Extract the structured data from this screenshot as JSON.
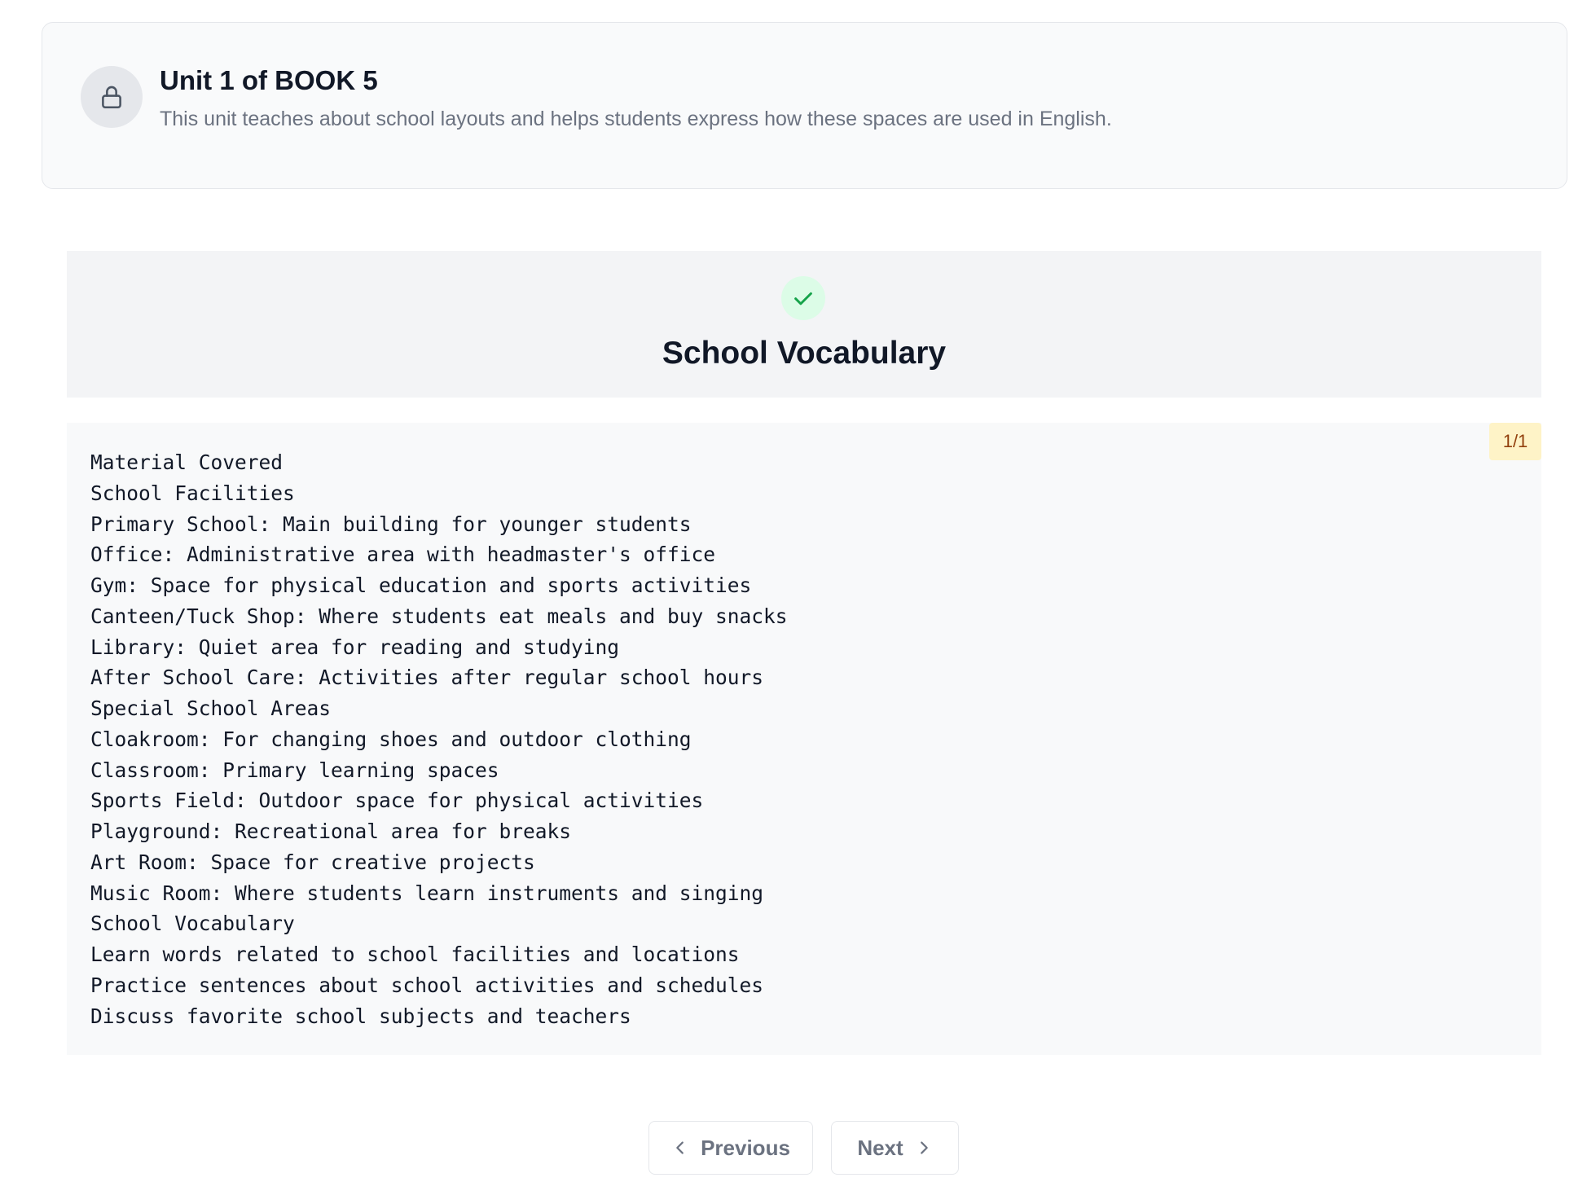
{
  "unit": {
    "title": "Unit 1 of BOOK 5",
    "description": "This unit teaches about school layouts and helps students express how these spaces are used in English.",
    "icon": "lock-icon"
  },
  "lesson": {
    "title": "School Vocabulary",
    "status_icon": "check-icon",
    "status_color": "#16a34a"
  },
  "content": {
    "page_indicator": "1/1",
    "lines": [
      "Material Covered",
      "School Facilities",
      "Primary School: Main building for younger students",
      "Office: Administrative area with headmaster's office",
      "Gym: Space for physical education and sports activities",
      "Canteen/Tuck Shop: Where students eat meals and buy snacks",
      "Library: Quiet area for reading and studying",
      "After School Care: Activities after regular school hours",
      "Special School Areas",
      "Cloakroom: For changing shoes and outdoor clothing",
      "Classroom: Primary learning spaces",
      "Sports Field: Outdoor space for physical activities",
      "Playground: Recreational area for breaks",
      "Art Room: Space for creative projects",
      "Music Room: Where students learn instruments and singing",
      "School Vocabulary",
      "Learn words related to school facilities and locations",
      "Practice sentences about school activities and schedules",
      "Discuss favorite school subjects and teachers"
    ]
  },
  "pagination": {
    "previous_label": "Previous",
    "next_label": "Next",
    "previous_icon": "chevron-left-icon",
    "next_icon": "chevron-right-icon"
  }
}
